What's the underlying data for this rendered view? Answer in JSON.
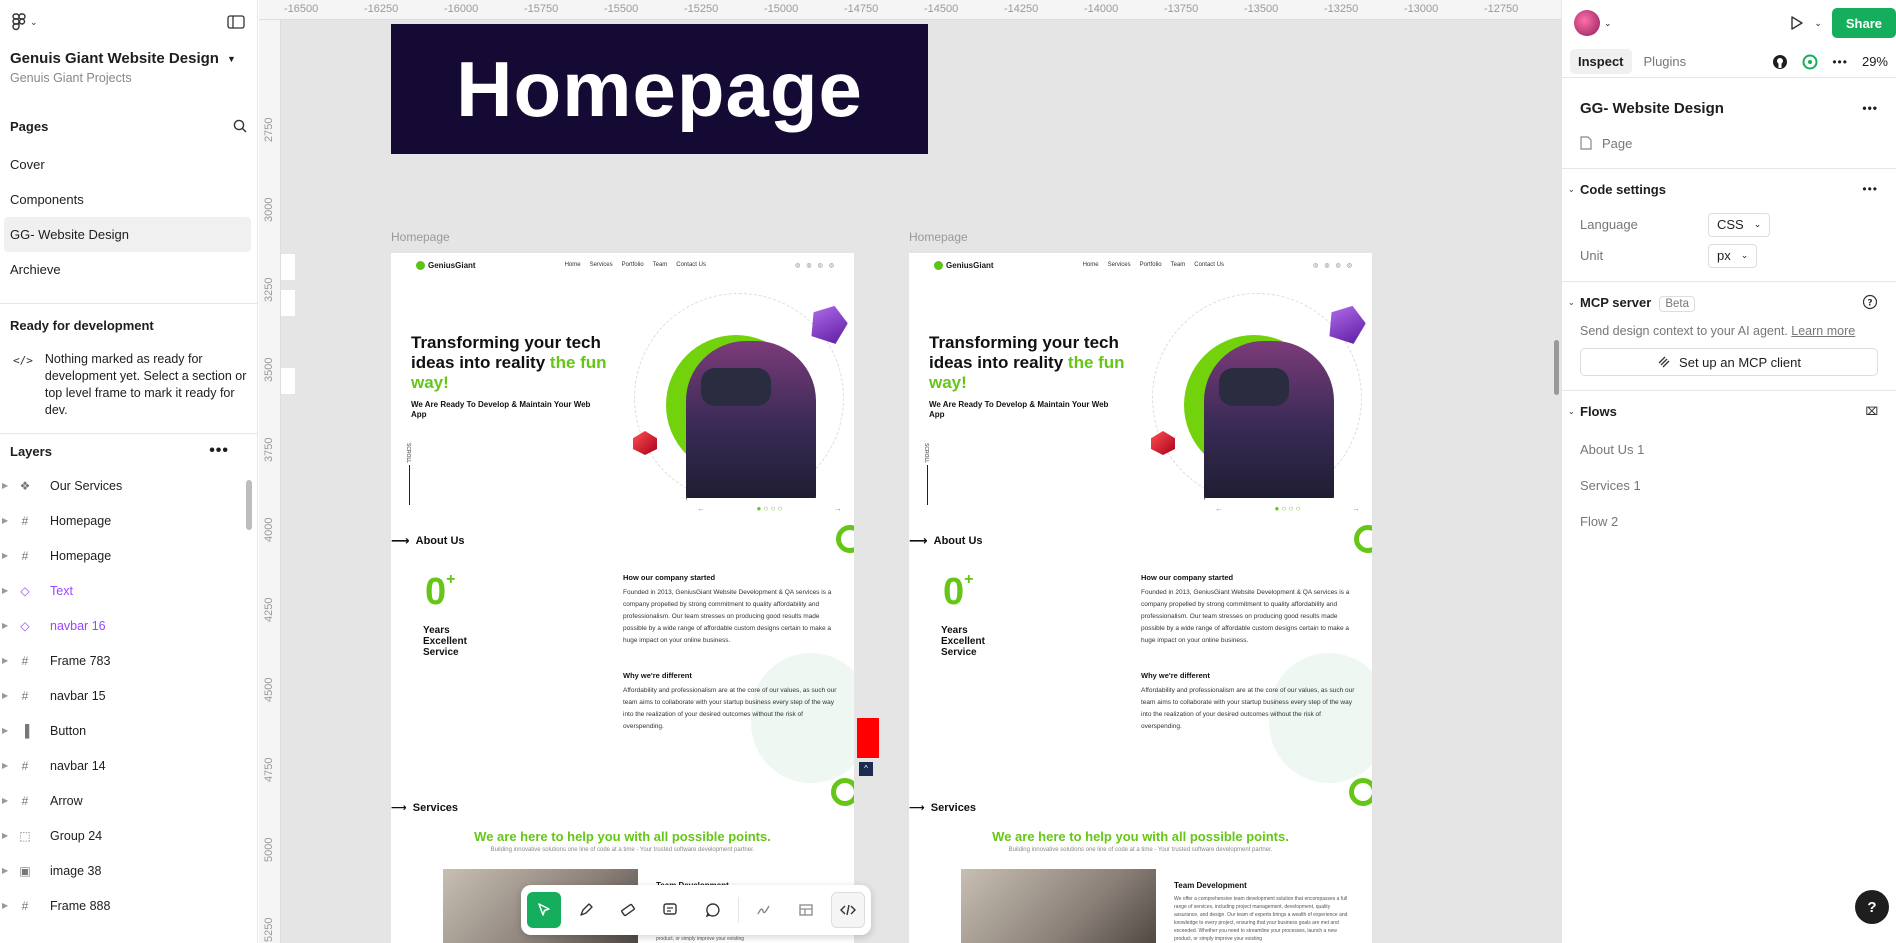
{
  "file": {
    "title": "Genuis Giant Website Design",
    "project": "Genuis Giant Projects"
  },
  "pages": {
    "heading": "Pages",
    "items": [
      "Cover",
      "Components",
      "GG- Website Design",
      "Archieve"
    ]
  },
  "ready": {
    "title": "Ready for development",
    "body": "Nothing marked as ready for development yet. Select a section or top level frame to mark it ready for dev."
  },
  "layers": {
    "heading": "Layers",
    "items": [
      {
        "name": "Our Services",
        "icon": "component-set-icon"
      },
      {
        "name": "Homepage",
        "icon": "frame-icon"
      },
      {
        "name": "Homepage",
        "icon": "frame-icon"
      },
      {
        "name": "Text",
        "icon": "component-instance-icon"
      },
      {
        "name": "navbar 16",
        "icon": "component-instance-icon"
      },
      {
        "name": "Frame 783",
        "icon": "frame-icon"
      },
      {
        "name": "navbar 15",
        "icon": "frame-icon"
      },
      {
        "name": "Button",
        "icon": "autolayout-icon"
      },
      {
        "name": "navbar 14",
        "icon": "frame-icon"
      },
      {
        "name": "Arrow",
        "icon": "frame-icon"
      },
      {
        "name": "Group 24",
        "icon": "group-icon"
      },
      {
        "name": "image 38",
        "icon": "image-icon"
      },
      {
        "name": "Frame 888",
        "icon": "frame-icon"
      }
    ]
  },
  "rulers": {
    "top": [
      "-16500",
      "-16250",
      "-16000",
      "-15750",
      "-15500",
      "-15250",
      "-15000",
      "-14750",
      "-14500",
      "-14250",
      "-14000",
      "-13750",
      "-13500",
      "-13250",
      "-13000",
      "-12750"
    ],
    "left": [
      "2750",
      "3000",
      "3250",
      "3500",
      "3750",
      "4000",
      "4250",
      "4500",
      "4750",
      "5000",
      "5250"
    ]
  },
  "canvas": {
    "banner": "Homepage",
    "frames": [
      {
        "label": "Homepage"
      },
      {
        "label": "Homepage"
      }
    ]
  },
  "site": {
    "logo": "GeniusGiant",
    "nav": [
      "Home",
      "Services",
      "Portfolio",
      "Team",
      "Contact Us"
    ],
    "hero_title_a": "Transforming your tech ideas into reality",
    "hero_title_b": "the fun way!",
    "hero_sub": "We Are Ready To Develop & Maintain Your Web App",
    "scroll": "SCROLL",
    "about": "About Us",
    "counter": "0",
    "counter_sup": "+",
    "years": "Years Excellent Service",
    "h1": "How our company started",
    "p1": "Founded in 2013, GeniusGiant Website Development & QA services is a company propelled by strong commitment to quality affordability and professionalism. Our team stresses on producing good results made possible by a wide range of affordable custom designs certain to make a huge impact on your online business.",
    "h2": "Why we're different",
    "p2": "Affordability and professionalism are at the core of our values, as such our team aims to collaborate with your startup business every step of the way into the realization of your desired outcomes without the risk of overspending.",
    "services": "Services",
    "here": "We are here to help you with all possible points.",
    "building": "Building innovative solutions one line of code at a time - Your trusted software development partner.",
    "team_title": "Team Development",
    "team_body": "We offer a comprehensive team development solution that encompasses a full range of services, including project management, development, quality assurance, and design. Our team of experts brings a wealth of experience and knowledge to every project, ensuring that your business goals are met and exceeded. Whether you need to streamline your processes, launch a new product, or simply improve your existing"
  },
  "right": {
    "share": "Share",
    "tabs": [
      "Inspect",
      "Plugins"
    ],
    "zoom": "29%",
    "selection_title": "GG- Website Design",
    "selection_type": "Page",
    "code_settings": "Code settings",
    "language_label": "Language",
    "language_value": "CSS",
    "unit_label": "Unit",
    "unit_value": "px",
    "mcp_title": "MCP server",
    "mcp_beta": "Beta",
    "mcp_desc": "Send design context to your AI agent.",
    "mcp_learn": "Learn more",
    "mcp_button": "Set up an MCP client",
    "flows_title": "Flows",
    "flows": [
      "About Us 1",
      "Services 1",
      "Flow 2"
    ],
    "help": "?"
  },
  "colors": {
    "accent": "#14ae5c",
    "brand_green": "#65c617",
    "component": "#9747ff",
    "banner_bg": "#150a34"
  }
}
